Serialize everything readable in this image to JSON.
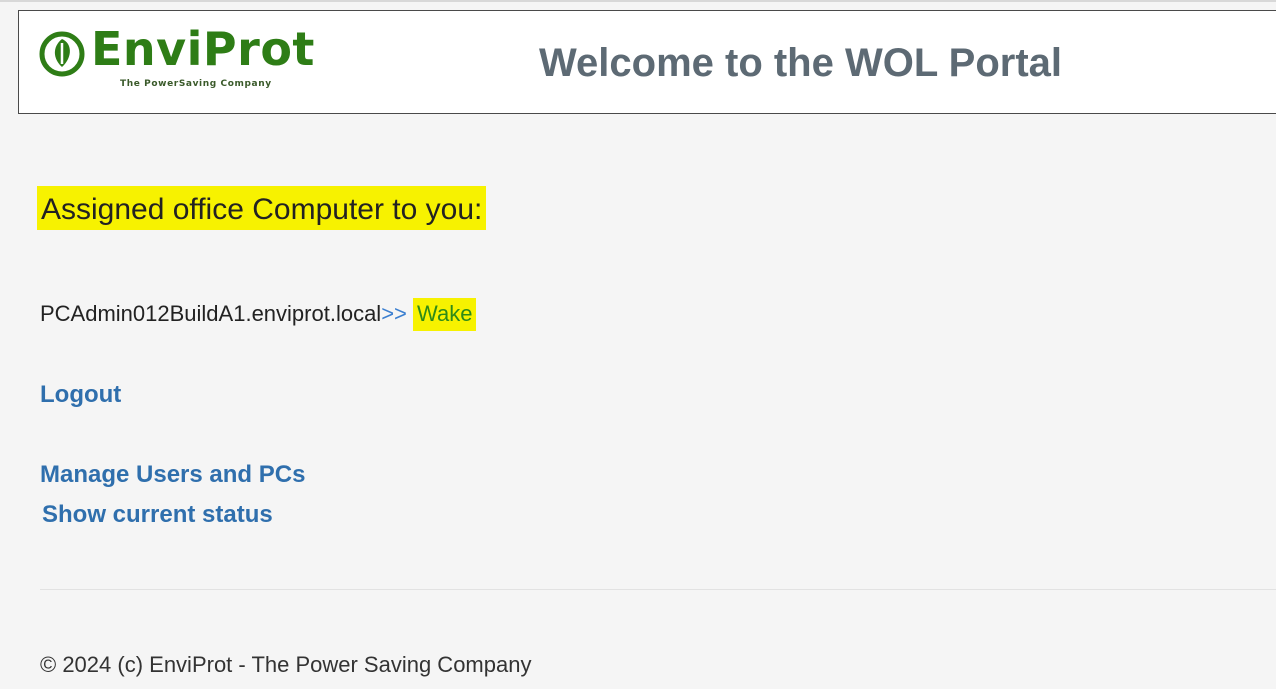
{
  "header": {
    "logo": {
      "brand": "EnviProt",
      "tagline": "The PowerSaving Company",
      "brand_color": "#2e7d16"
    },
    "title": "Welcome to the WOL Portal"
  },
  "main": {
    "assigned_heading": "Assigned office Computer to you:",
    "computer": {
      "hostname": "PCAdmin012BuildA1.enviprot.local",
      "arrows": ">>",
      "action_label": "Wake"
    },
    "links": {
      "logout": "Logout",
      "manage": "Manage Users and PCs",
      "status": "Show current status"
    }
  },
  "footer": {
    "copyright": "© 2024 (c) EnviProt - The Power Saving Company"
  },
  "colors": {
    "highlight": "#f7f200",
    "link": "#2f6fad",
    "title": "#5d6a74"
  }
}
